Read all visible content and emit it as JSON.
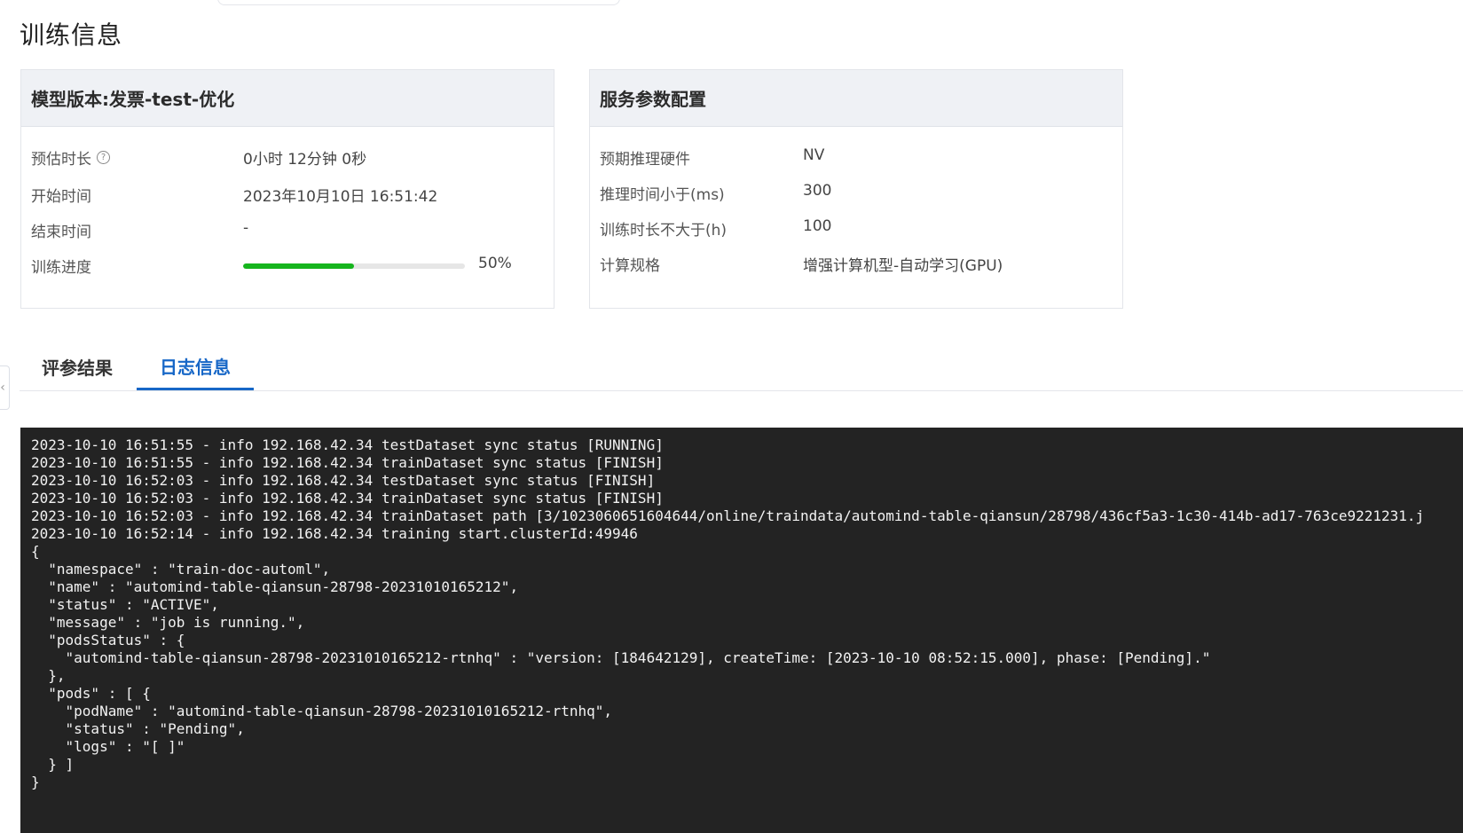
{
  "page_title": "训练信息",
  "model_card": {
    "title": "模型版本:发票-test-优化",
    "rows": [
      {
        "label": "预估时长",
        "value": "0小时 12分钟 0秒"
      },
      {
        "label": "开始时间",
        "value": "2023年10月10日 16:51:42"
      },
      {
        "label": "结束时间",
        "value": "-"
      },
      {
        "label": "训练进度",
        "value": "50%"
      }
    ],
    "help_icon_glyph": "?",
    "progress_fraction": 0.5,
    "progress_color": "#16b51d"
  },
  "service_card": {
    "title": "服务参数配置",
    "rows": [
      {
        "label": "预期推理硬件",
        "value": "NV"
      },
      {
        "label": "推理时间小于(ms)",
        "value": "300"
      },
      {
        "label": "训练时长不大于(h)",
        "value": "100"
      },
      {
        "label": "计算规格",
        "value": "增强计算机型-自动学习(GPU)"
      }
    ]
  },
  "tabs": [
    {
      "label": "评参结果",
      "active": false
    },
    {
      "label": "日志信息",
      "active": true
    }
  ],
  "accent_color": "#1767c7",
  "collapse_handle_glyph": "‹",
  "log_lines": [
    "2023-10-10 16:51:55 - info 192.168.42.34 testDataset sync status [RUNNING]",
    "2023-10-10 16:51:55 - info 192.168.42.34 trainDataset sync status [FINISH]",
    "2023-10-10 16:52:03 - info 192.168.42.34 testDataset sync status [FINISH]",
    "2023-10-10 16:52:03 - info 192.168.42.34 trainDataset sync status [FINISH]",
    "2023-10-10 16:52:03 - info 192.168.42.34 trainDataset path [3/1023060651604644/online/traindata/automind-table-qiansun/28798/436cf5a3-1c30-414b-ad17-763ce9221231.j",
    "2023-10-10 16:52:14 - info 192.168.42.34 training start.clusterId:49946",
    "{",
    "  \"namespace\" : \"train-doc-automl\",",
    "  \"name\" : \"automind-table-qiansun-28798-20231010165212\",",
    "  \"status\" : \"ACTIVE\",",
    "  \"message\" : \"job is running.\",",
    "  \"podsStatus\" : {",
    "    \"automind-table-qiansun-28798-20231010165212-rtnhq\" : \"version: [184642129], createTime: [2023-10-10 08:52:15.000], phase: [Pending].\"",
    "  },",
    "  \"pods\" : [ {",
    "    \"podName\" : \"automind-table-qiansun-28798-20231010165212-rtnhq\",",
    "    \"status\" : \"Pending\",",
    "    \"logs\" : \"[ ]\"",
    "  } ]",
    "}"
  ]
}
